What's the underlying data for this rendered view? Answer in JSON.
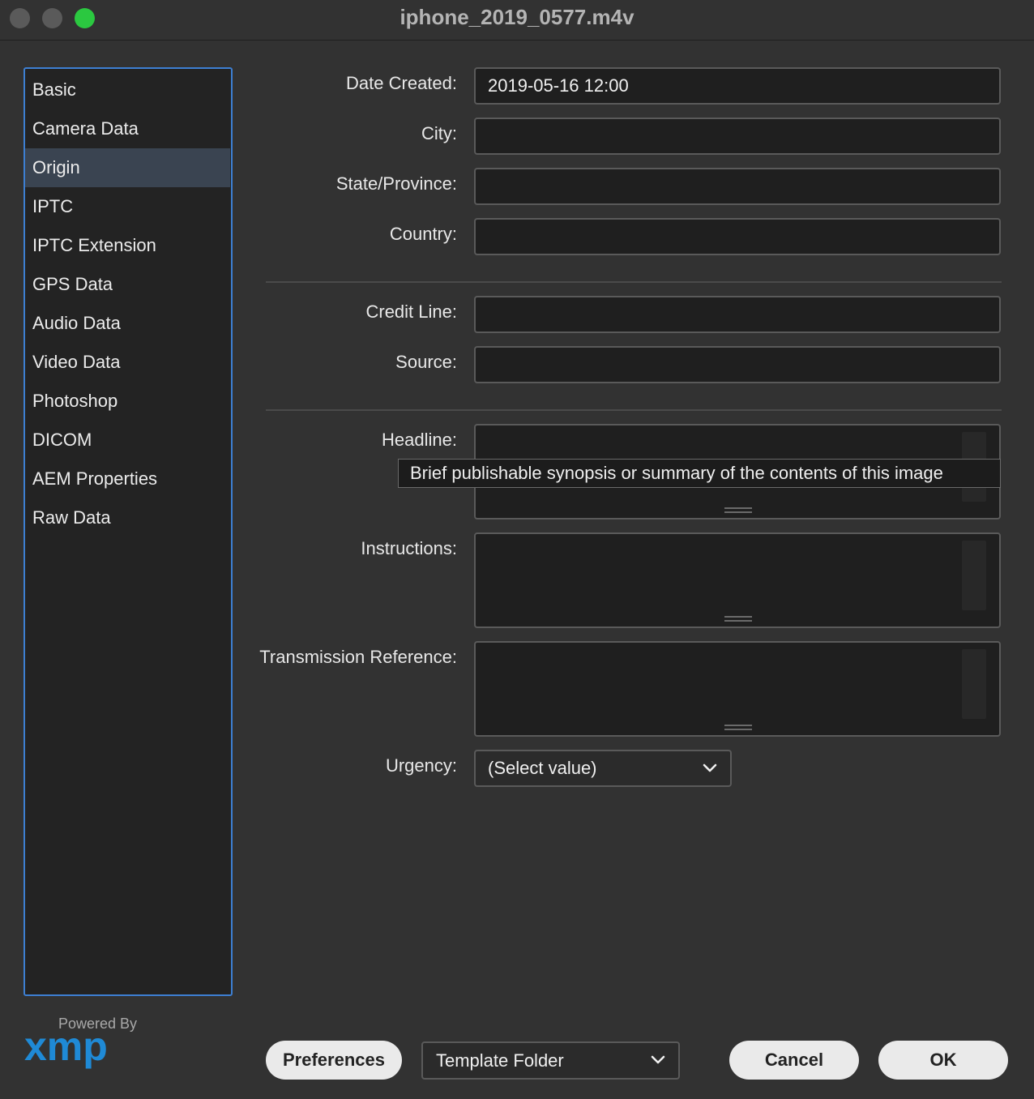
{
  "window": {
    "title": "iphone_2019_0577.m4v"
  },
  "sidebar": {
    "items": [
      {
        "label": "Basic"
      },
      {
        "label": "Camera Data"
      },
      {
        "label": "Origin",
        "selected": true
      },
      {
        "label": "IPTC"
      },
      {
        "label": "IPTC Extension"
      },
      {
        "label": "GPS Data"
      },
      {
        "label": "Audio Data"
      },
      {
        "label": "Video Data"
      },
      {
        "label": "Photoshop"
      },
      {
        "label": "DICOM"
      },
      {
        "label": "AEM Properties"
      },
      {
        "label": "Raw Data"
      }
    ]
  },
  "form": {
    "date_created": {
      "label": "Date Created:",
      "value": "2019-05-16 12:00"
    },
    "city": {
      "label": "City:",
      "value": ""
    },
    "state": {
      "label": "State/Province:",
      "value": ""
    },
    "country": {
      "label": "Country:",
      "value": ""
    },
    "credit_line": {
      "label": "Credit Line:",
      "value": ""
    },
    "source": {
      "label": "Source:",
      "value": ""
    },
    "headline": {
      "label": "Headline:",
      "value": ""
    },
    "instructions": {
      "label": "Instructions:",
      "value": ""
    },
    "transmission_reference": {
      "label": "Transmission Reference:",
      "value": ""
    },
    "urgency": {
      "label": "Urgency:",
      "value": "(Select value)"
    }
  },
  "tooltip": {
    "text": "Brief publishable synopsis or summary of the contents of this image"
  },
  "footer": {
    "powered_by": "Powered By",
    "logo_text": "xmp",
    "preferences_label": "Preferences",
    "template_folder_label": "Template Folder",
    "cancel_label": "Cancel",
    "ok_label": "OK"
  },
  "colors": {
    "accent": "#3d7fd2",
    "selected_row": "#3a4451",
    "close": "#5a5a5a",
    "zoom": "#2bc840",
    "logo": "#1f8ad6"
  }
}
